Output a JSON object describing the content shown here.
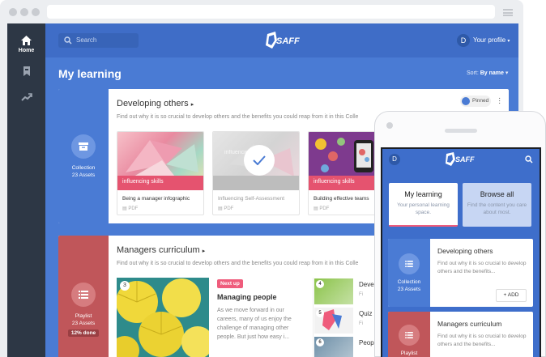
{
  "colors": {
    "primary": "#4a7bd4",
    "sidebar": "#2d3745",
    "playlist": "#c0565a",
    "accent_pink": "#ef5c7c"
  },
  "sidebar": {
    "items": [
      {
        "icon": "home-icon",
        "label": "Home"
      },
      {
        "icon": "bookmark-icon"
      },
      {
        "icon": "trending-icon"
      }
    ]
  },
  "header": {
    "search_placeholder": "Search",
    "logo": "SAFF",
    "profile_initial": "D",
    "profile_label": "Your profile"
  },
  "page": {
    "title": "My learning",
    "sort_label": "Sort:",
    "sort_value": "By name"
  },
  "collection": {
    "title": "Developing others",
    "description": "Find out why it is so crucial to develop others and the benefits you could reap from it in this Colle",
    "side_type": "Collection",
    "side_count": "23 Assets",
    "pinned": "Pinned",
    "assets": [
      {
        "name": "Being a manager infographic",
        "type": "PDF",
        "thumb_text": "influencing skills"
      },
      {
        "name": "Influencing Self-Assessment",
        "type": "PDF",
        "thumb_text": "influencing skills"
      },
      {
        "name": "Building effective teams",
        "type": "PDF",
        "thumb_text": "influencing skills"
      }
    ]
  },
  "playlist": {
    "title": "Managers curriculum",
    "description": "Find out why it is so crucial to develop others and the benefits you could reap from it in this Colle",
    "side_type": "Playlist",
    "side_count": "23 Assets",
    "progress_label": "12% done",
    "first_number": "3",
    "next_up": "Next up",
    "next_title": "Managing people",
    "next_desc": "As we move forward in our careers, many of us enjoy the challenge of managing other people. But just how easy i...",
    "items": [
      {
        "num": "4",
        "title": "Deve",
        "type": "Fi"
      },
      {
        "num": "5",
        "title": "Quiz",
        "type": "Fi"
      },
      {
        "num": "6",
        "title": "Peop",
        "type": ""
      }
    ]
  },
  "mobile": {
    "initial": "D",
    "logo": "SAFF",
    "tab_mine": {
      "title": "My learning",
      "sub": "Your personal learning space."
    },
    "tab_browse": {
      "title": "Browse all",
      "sub": "Find the content you care about most."
    },
    "collection": {
      "type": "Collection",
      "count": "23 Assets",
      "title": "Developing others",
      "desc": "Find out why it is so crucial to develop others and the benefits...",
      "add": "ADD"
    },
    "playlist": {
      "type": "Playlist",
      "title": "Managers curriculum",
      "desc": "Find out why it is so crucial to develop others and the benefits..."
    }
  }
}
